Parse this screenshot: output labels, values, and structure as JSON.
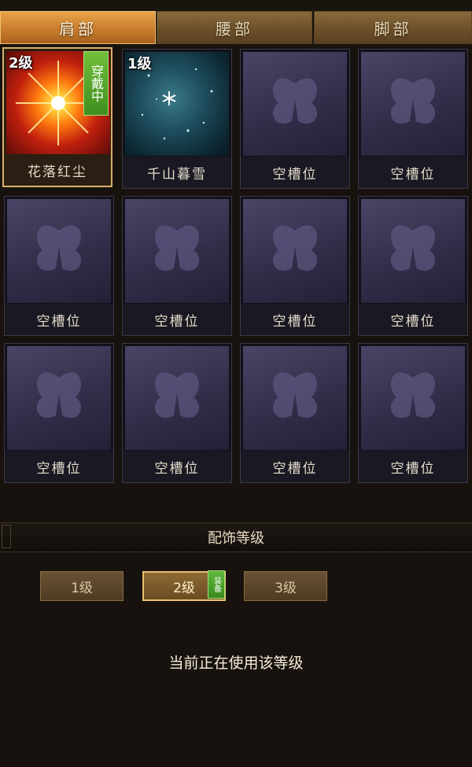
{
  "tabs": [
    {
      "label": "肩部",
      "active": true
    },
    {
      "label": "腰部",
      "active": false
    },
    {
      "label": "脚部",
      "active": false
    }
  ],
  "slots": [
    {
      "name": "花落红尘",
      "level": "2级",
      "tag": "穿戴中",
      "art": "sun-burst-icon"
    },
    {
      "name": "千山暮雪",
      "level": "1级",
      "tag": "",
      "art": "snowflake-icon"
    },
    {
      "name": "空槽位"
    },
    {
      "name": "空槽位"
    },
    {
      "name": "空槽位"
    },
    {
      "name": "空槽位"
    },
    {
      "name": "空槽位"
    },
    {
      "name": "空槽位"
    },
    {
      "name": "空槽位"
    },
    {
      "name": "空槽位"
    },
    {
      "name": "空槽位"
    },
    {
      "name": "空槽位"
    }
  ],
  "empty_art_icon": "butterfly-icon",
  "section": {
    "title": "配饰等级"
  },
  "levels": [
    {
      "label": "1级",
      "active": false
    },
    {
      "label": "2级",
      "active": true,
      "tag": "装备"
    },
    {
      "label": "3级",
      "active": false
    }
  ],
  "status_text": "当前正在使用该等级",
  "colors": {
    "active_tab": "#c97d2c",
    "equip_tag": "#3f8e1e",
    "selected_border": "#d8b06a"
  }
}
